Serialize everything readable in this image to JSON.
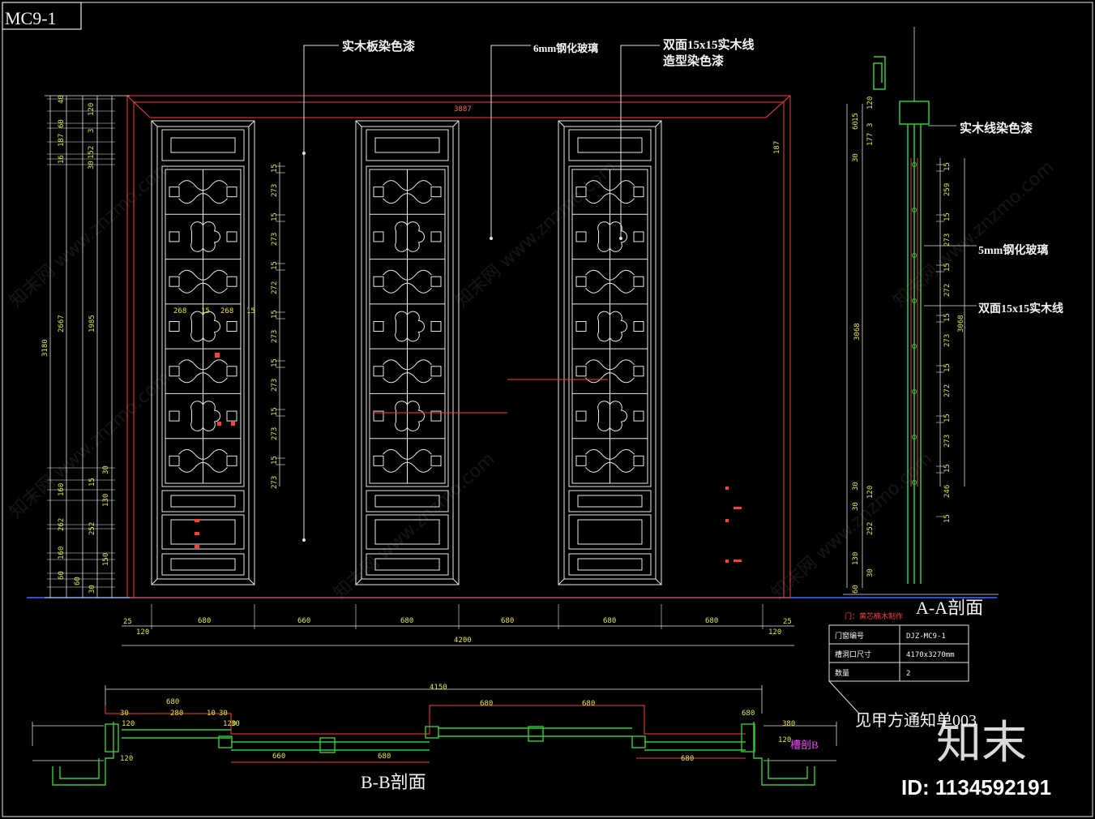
{
  "drawing": {
    "code": "MC9-1",
    "annotations": {
      "wood_panel": "实木板染色漆",
      "glass_6mm": "6mm钢化玻璃",
      "wood_line_l1": "双面15x15实木线",
      "wood_line_l2": "造型染色漆"
    },
    "top_dim": "3887",
    "left_dims": {
      "outer": "3180",
      "mid": "2667",
      "inner": "1985",
      "tops": [
        "40",
        "120",
        "60",
        "3",
        "187",
        "152",
        "16",
        "30"
      ],
      "bottoms": [
        "30",
        "15",
        "160",
        "130",
        "262",
        "252",
        "160",
        "150",
        "60",
        "60",
        "30"
      ]
    },
    "rail_pitch": [
      "15",
      "273",
      "15",
      "273",
      "15",
      "272",
      "15",
      "273",
      "15",
      "273",
      "15",
      "273",
      "15",
      "273"
    ],
    "small_dims": [
      "268",
      "15",
      "268",
      "15",
      "187"
    ],
    "bottom_dims": {
      "edges": [
        "25",
        "120",
        "120",
        "25"
      ],
      "panels": [
        "680",
        "660",
        "680",
        "680",
        "680",
        "680"
      ],
      "total": "4200"
    }
  },
  "section_aa": {
    "title": "A-A剖面",
    "labels": {
      "wood_line_paint": "实木线染色漆",
      "glass_5mm": "5mm钢化玻璃",
      "wood_line": "双面15x15实木线"
    },
    "left_dims": [
      "120",
      "15",
      "3",
      "60",
      "177",
      "30",
      "3068",
      "30",
      "120",
      "30",
      "252",
      "130",
      "30",
      "60"
    ],
    "right_dims": [
      "15",
      "259",
      "15",
      "273",
      "15",
      "272",
      "15",
      "273",
      "15",
      "272",
      "15",
      "273",
      "15",
      "246",
      "15",
      "3068"
    ]
  },
  "info_table": {
    "note": "门：黄芯楠木制作",
    "rows": [
      {
        "label": "门窗编号",
        "value": "DJZ-MC9-1"
      },
      {
        "label": "槽洞口尺寸",
        "value": "4170x3270mm"
      },
      {
        "label": "数量",
        "value": "2"
      }
    ],
    "ref_note": "见甲方通知单003"
  },
  "section_bb": {
    "title": "B-B剖面",
    "tag": "槽剖B",
    "total": "4150",
    "dims": [
      "680",
      "30",
      "280",
      "10",
      "30",
      "120",
      "30",
      "660",
      "680",
      "680",
      "680",
      "680",
      "680",
      "120",
      "120",
      "380",
      "120"
    ]
  },
  "watermark": {
    "brand": "知末",
    "id": "ID: 1134592191",
    "text": "知末网 www.znzmo.com"
  }
}
